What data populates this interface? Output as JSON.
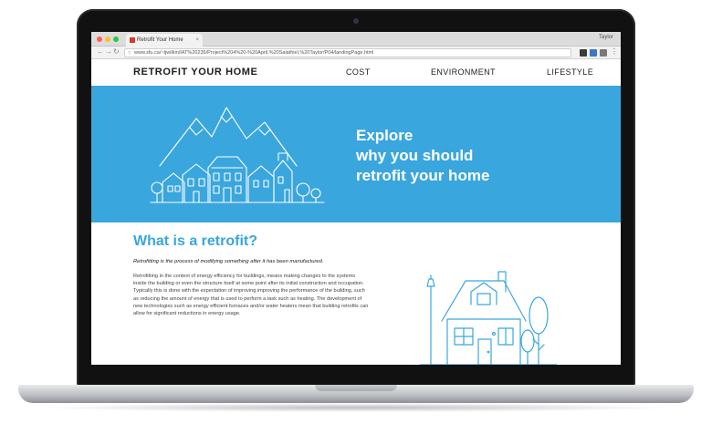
{
  "browser": {
    "tab_title": "Retrofit Your Home",
    "tab_close": "×",
    "profile": "Taylor",
    "url": "www.sfu.ca/~tjwilkin/IAT%20235/Project%204%20-%20April,%20Salathiel,%20Taylor/P04/landingPage.html"
  },
  "nav": {
    "brand": "RETROFIT YOUR HOME",
    "links": [
      "COST",
      "ENVIRONMENT",
      "LIFESTYLE"
    ]
  },
  "hero": {
    "heading_lines": [
      "Explore",
      "why you should",
      "retrofit your home"
    ],
    "background_color": "#3aa6de"
  },
  "section": {
    "title": "What is a retrofit?",
    "lead": "Retrofitting is the process of modifying something after it has been manufactured.",
    "body": "Retrofitting in the context of energy efficiency for buildings, means making changes to the systems inside the building or even the structure itself at some point after its initial construction and occupation. Typically this is done with the expectation of improving improving the performance of the building, such as reducing the amount of energy that is used to perform a task such as heating. The development of new technologies such as energy efficient furnaces and/or water heaters mean that building retrofits can allow for significant reductions in energy usage."
  },
  "colors": {
    "accent": "#3aa6de",
    "frame": "#111111"
  },
  "icons": {
    "back": "back-arrow-icon",
    "forward": "forward-arrow-icon",
    "reload": "reload-icon",
    "lock": "lock-icon",
    "bookmark": "star-icon",
    "menu": "menu-icon"
  }
}
